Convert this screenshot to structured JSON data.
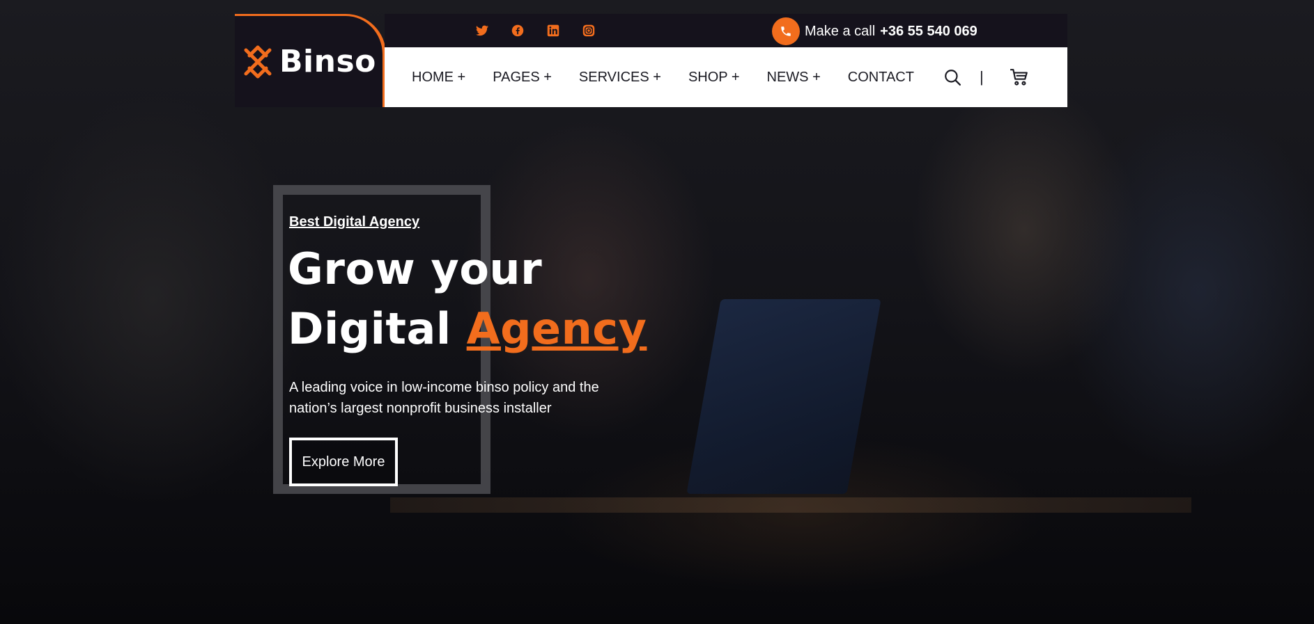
{
  "brand": {
    "name": "Binso",
    "accent_color": "#f26d1d",
    "dark_color": "#15121c"
  },
  "topbar": {
    "social_icons": [
      "twitter-icon",
      "facebook-icon",
      "linkedin-icon",
      "instagram-icon"
    ],
    "call_label": "Make a call",
    "call_number": "+36 55 540 069"
  },
  "nav": {
    "items": [
      {
        "label": "HOME +"
      },
      {
        "label": "PAGES +"
      },
      {
        "label": "SERVICES +"
      },
      {
        "label": "SHOP +"
      },
      {
        "label": "NEWS +"
      },
      {
        "label": "CONTACT"
      }
    ],
    "divider": "|",
    "tool_icons": [
      "search-icon",
      "cart-icon"
    ]
  },
  "hero": {
    "tagline": "Best Digital Agency",
    "title_line1": "Grow your",
    "title_line2_plain": "Digital ",
    "title_line2_accent": "Agency",
    "description": "A leading voice in low-income binso policy and the nation’s largest nonprofit business installer",
    "cta_label": "Explore More"
  }
}
